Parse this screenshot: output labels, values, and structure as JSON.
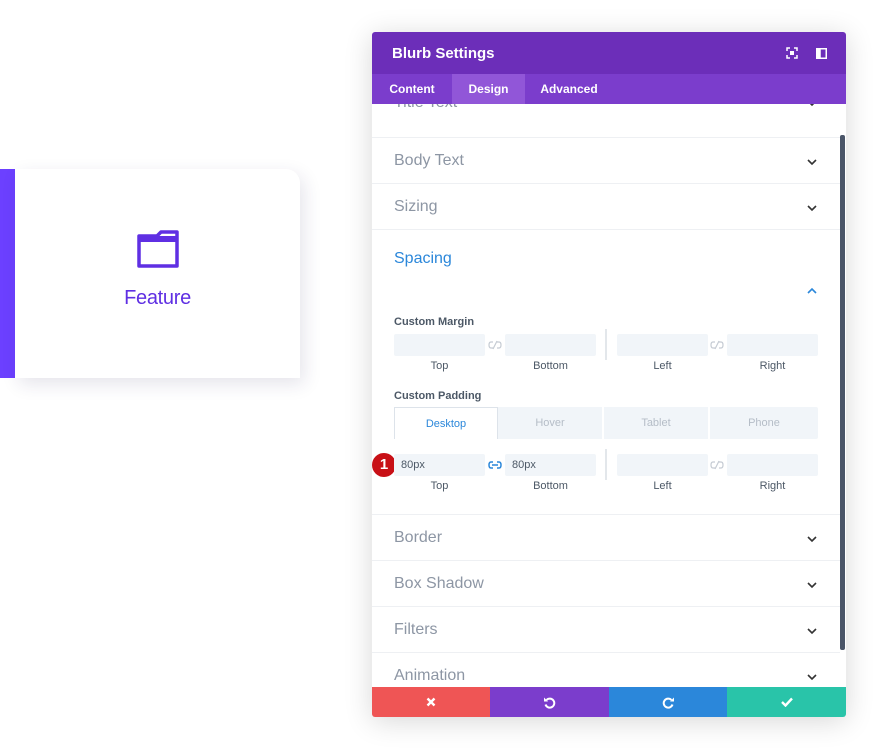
{
  "preview": {
    "card_title": "Feature",
    "icon": "folder-icon",
    "accent_color": "#6c40ff",
    "title_color": "#5f2fe3"
  },
  "modal": {
    "title": "Blurb Settings",
    "header_buttons": [
      "fullscreen-icon",
      "sidebar-toggle-icon"
    ],
    "tabs": [
      {
        "label": "Content",
        "active": false
      },
      {
        "label": "Design",
        "active": true
      },
      {
        "label": "Advanced",
        "active": false
      }
    ],
    "sections_top": [
      {
        "label": "Title Text"
      },
      {
        "label": "Body Text"
      },
      {
        "label": "Sizing"
      }
    ],
    "spacing": {
      "title": "Spacing",
      "margin_label": "Custom Margin",
      "margin": {
        "top": {
          "value": "",
          "caption": "Top"
        },
        "bottom": {
          "value": "",
          "caption": "Bottom"
        },
        "left": {
          "value": "",
          "caption": "Left"
        },
        "right": {
          "value": "",
          "caption": "Right"
        }
      },
      "padding_label": "Custom Padding",
      "device_tabs": [
        {
          "label": "Desktop",
          "active": true
        },
        {
          "label": "Hover",
          "active": false
        },
        {
          "label": "Tablet",
          "active": false
        },
        {
          "label": "Phone",
          "active": false
        }
      ],
      "padding": {
        "top": {
          "value": "80px",
          "caption": "Top"
        },
        "bottom": {
          "value": "80px",
          "caption": "Bottom"
        },
        "left": {
          "value": "",
          "caption": "Left"
        },
        "right": {
          "value": "",
          "caption": "Right"
        }
      },
      "step_badge": "1"
    },
    "sections_bottom": [
      {
        "label": "Border"
      },
      {
        "label": "Box Shadow"
      },
      {
        "label": "Filters"
      },
      {
        "label": "Animation"
      }
    ],
    "footer": [
      {
        "action": "cancel",
        "icon": "close-icon",
        "color": "#ef5555"
      },
      {
        "action": "undo",
        "icon": "undo-icon",
        "color": "#7b3dcc"
      },
      {
        "action": "redo",
        "icon": "redo-icon",
        "color": "#2b87da"
      },
      {
        "action": "save",
        "icon": "check-icon",
        "color": "#29c4a9"
      }
    ],
    "colors": {
      "header": "#6c2eb9",
      "tabs": "#7b3dcc",
      "active_tab": "#9156d8",
      "link_active": "#2b87da"
    }
  }
}
